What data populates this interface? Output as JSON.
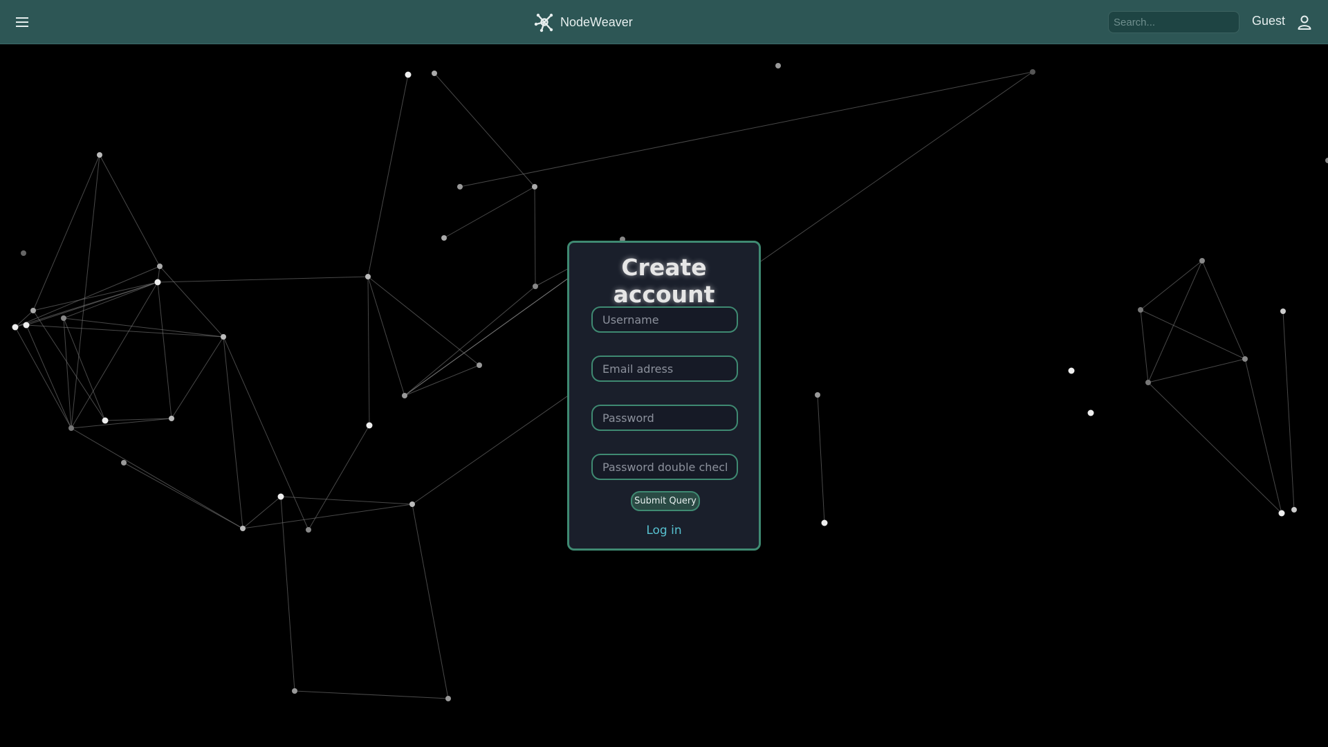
{
  "header": {
    "app_name": "NodeWeaver",
    "search_placeholder": "Search...",
    "user_label": "Guest"
  },
  "form": {
    "title": "Create account",
    "username_placeholder": "Username",
    "email_placeholder": "Email adress",
    "password_placeholder": "Password",
    "password_check_placeholder": "Password double check",
    "submit_label": "Submit Query",
    "login_link": "Log in"
  },
  "colors": {
    "header_bg": "#2d5655",
    "accent": "#3f8a72",
    "card_bg": "#1a1f2b",
    "link": "#57c1d0",
    "background": "#000000"
  },
  "icons": {
    "menu": "hamburger-menu-icon",
    "logo": "network-graph-icon",
    "user": "user-icon"
  }
}
